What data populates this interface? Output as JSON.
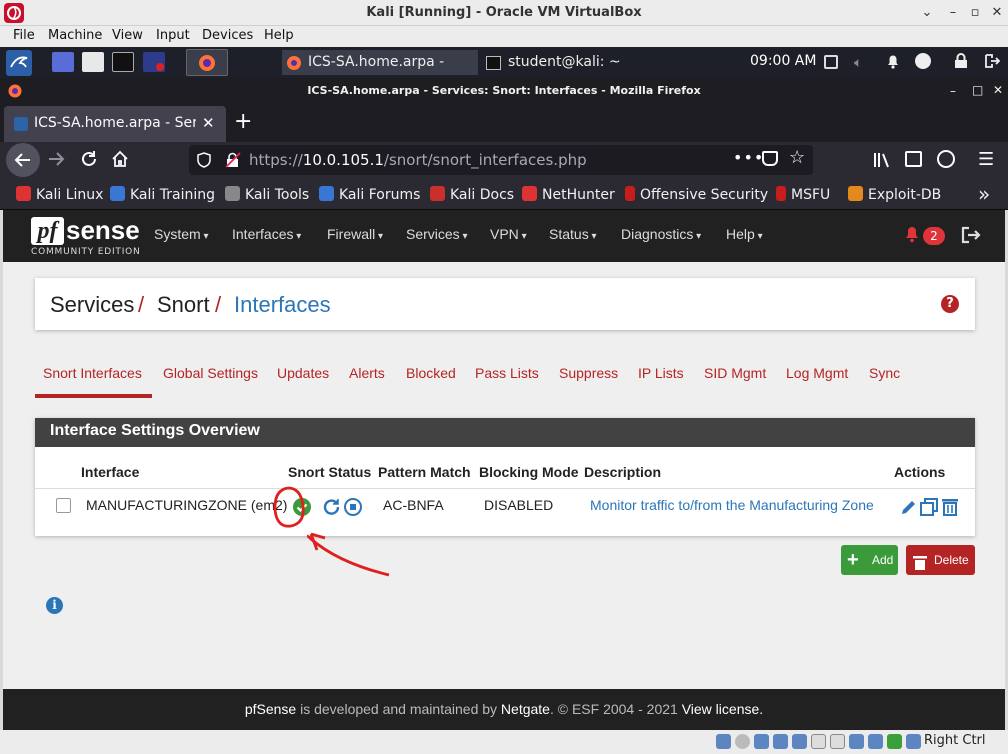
{
  "vbox": {
    "title": "Kali [Running] - Oracle VM VirtualBox",
    "menu": [
      "File",
      "Machine",
      "View",
      "Input",
      "Devices",
      "Help"
    ],
    "host_key": "Right Ctrl"
  },
  "kali_panel": {
    "tasks": [
      "ICS-SA.home.arpa - Ser…",
      "student@kali: ~"
    ],
    "clock": "09:00 AM"
  },
  "firefox": {
    "window_title": "ICS-SA.home.arpa - Services: Snort: Interfaces - Mozilla Firefox",
    "tab_title": "ICS-SA.home.arpa - Serv",
    "url_prefix": "https://",
    "url_host": "10.0.105.1",
    "url_path": "/snort/snort_interfaces.php",
    "bookmarks": [
      "Kali Linux",
      "Kali Training",
      "Kali Tools",
      "Kali Forums",
      "Kali Docs",
      "NetHunter",
      "Offensive Security",
      "MSFU",
      "Exploit-DB"
    ],
    "overflow": "»"
  },
  "pfsense": {
    "logo_pf": "pf",
    "logo_sense": "sense",
    "logo_sub": "COMMUNITY EDITION",
    "menu": [
      "System",
      "Interfaces",
      "Firewall",
      "Services",
      "VPN",
      "Status",
      "Diagnostics",
      "Help"
    ],
    "notification_count": "2",
    "breadcrumb": [
      "Services",
      "Snort",
      "Interfaces"
    ],
    "breadcrumb_sep": "/",
    "tabs": [
      "Snort Interfaces",
      "Global Settings",
      "Updates",
      "Alerts",
      "Blocked",
      "Pass Lists",
      "Suppress",
      "IP Lists",
      "SID Mgmt",
      "Log Mgmt",
      "Sync"
    ],
    "panel_title": "Interface Settings Overview",
    "columns": [
      "Interface",
      "Snort Status",
      "Pattern Match",
      "Blocking Mode",
      "Description",
      "Actions"
    ],
    "rows": [
      {
        "interface": "MANUFACTURINGZONE (em2)",
        "pattern_match": "AC-BNFA",
        "blocking_mode": "DISABLED",
        "description": "Monitor traffic to/from the Manufacturing Zone"
      }
    ],
    "add_label": "Add",
    "delete_label": "Delete",
    "footer": {
      "brand": "pfSense",
      "text1": " is developed and maintained by ",
      "maker": "Netgate",
      "text2": ". © ESF 2004 - 2021 ",
      "license": "View license."
    }
  },
  "colors": {
    "pf_red": "#b52424",
    "pf_link": "#2c76b7",
    "pf_dark": "#212121",
    "status_green": "#3c9a3c",
    "annotation": "#e0201e"
  }
}
